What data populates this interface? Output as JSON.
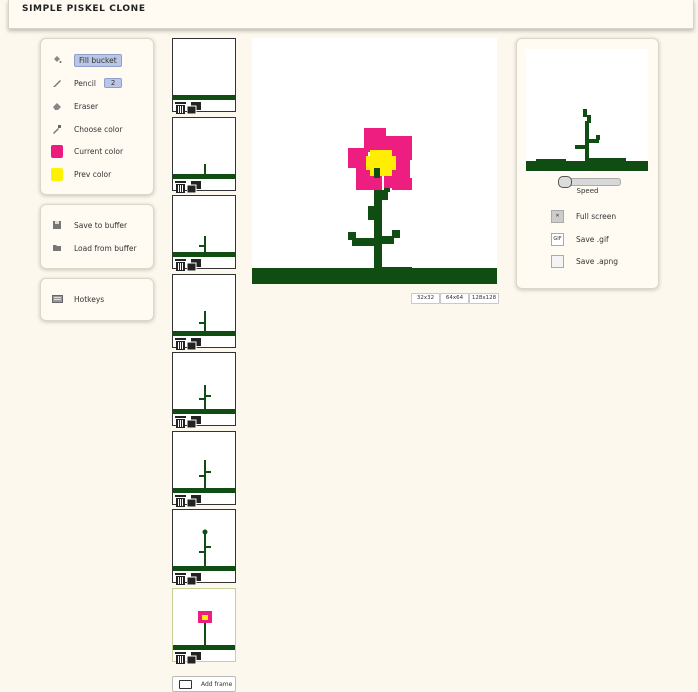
{
  "app": {
    "title": "SIMPLE PISKEL CLONE"
  },
  "tools": {
    "fill_bucket": "Fill bucket",
    "pencil": "Pencil",
    "pencil_size": "2",
    "eraser": "Eraser",
    "choose_color": "Choose color",
    "current_color": "Current color",
    "prev_color": "Prev color"
  },
  "colors": {
    "current": "#ec1b7e",
    "prev": "#fff200",
    "stem": "#0f4d12",
    "petal": "#ee1d80",
    "center": "#ffee00"
  },
  "buffer": {
    "save": "Save to buffer",
    "load": "Load from buffer"
  },
  "misc": {
    "hotkeys": "Hotkeys"
  },
  "frames": {
    "add_label": "Add frame",
    "count": 8,
    "selected_index": 8
  },
  "canvas_sizes": [
    "32x32",
    "64x64",
    "128x128"
  ],
  "preview": {
    "speed_label": "Speed",
    "full_screen": "Full screen",
    "save_gif": "Save .gif",
    "gif_icon_text": "GIF",
    "save_apng": "Save .apng"
  }
}
